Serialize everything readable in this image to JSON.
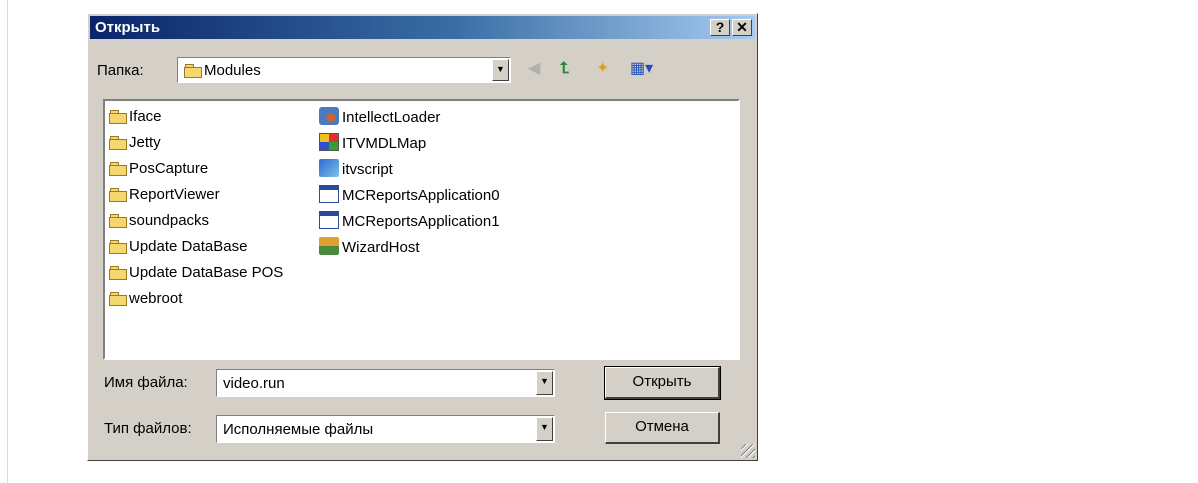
{
  "dialog": {
    "title": "Открыть",
    "help_label": "?",
    "close_label": "✕"
  },
  "lookin": {
    "label": "Папка:",
    "value": "Modules"
  },
  "toolbar": {
    "icons": [
      "back-icon",
      "up-folder-icon",
      "new-folder-icon",
      "view-menu-icon"
    ]
  },
  "files": {
    "folders": [
      "Iface",
      "Jetty",
      "PosCapture",
      "ReportViewer",
      "soundpacks",
      "Update DataBase",
      "Update DataBase POS",
      "webroot"
    ],
    "items": [
      "IntellectLoader",
      "ITVMDLMap",
      "itvscript",
      "MCReportsApplication0",
      "MCReportsApplication1",
      "WizardHost"
    ]
  },
  "filename": {
    "label": "Имя файла:",
    "value": "video.run"
  },
  "filetype": {
    "label": "Тип файлов:",
    "value": "Исполняемые файлы"
  },
  "buttons": {
    "open": "Открыть",
    "cancel": "Отмена"
  }
}
